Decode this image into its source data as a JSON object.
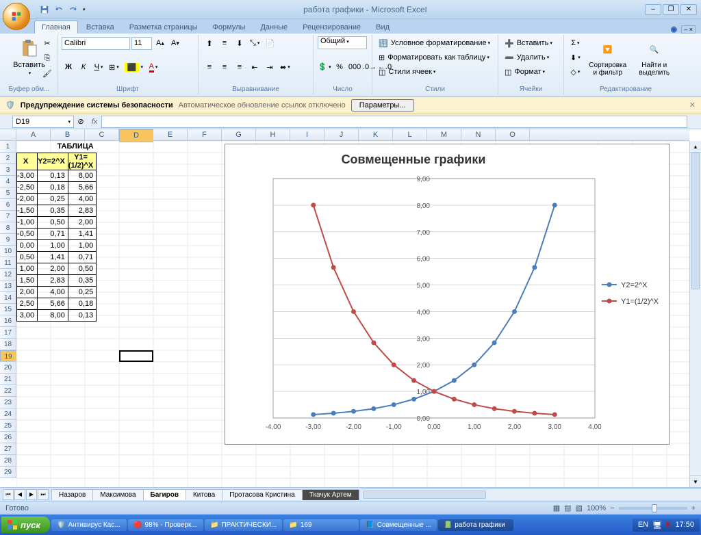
{
  "app": {
    "title": "работа графики - Microsoft Excel"
  },
  "qat": {
    "save": "save",
    "undo": "undo",
    "redo": "redo"
  },
  "tabs": [
    "Главная",
    "Вставка",
    "Разметка страницы",
    "Формулы",
    "Данные",
    "Рецензирование",
    "Вид"
  ],
  "active_tab": 0,
  "ribbon": {
    "clipboard": {
      "paste": "Вставить",
      "title": "Буфер обм..."
    },
    "font": {
      "name": "Calibri",
      "size": "11",
      "title": "Шрифт",
      "bold": "Ж",
      "italic": "К",
      "underline": "Ч"
    },
    "alignment": {
      "title": "Выравнивание"
    },
    "number": {
      "format": "Общий",
      "title": "Число"
    },
    "styles": {
      "cond": "Условное форматирование",
      "table": "Форматировать как таблицу",
      "cell": "Стили ячеек",
      "title": "Стили"
    },
    "cells": {
      "insert": "Вставить",
      "delete": "Удалить",
      "format": "Формат",
      "title": "Ячейки"
    },
    "editing": {
      "sort": "Сортировка и фильтр",
      "find": "Найти и выделить",
      "title": "Редактирование"
    }
  },
  "security": {
    "warn": "Предупреждение системы безопасности",
    "msg": "Автоматическое обновление ссылок отключено",
    "options": "Параметры..."
  },
  "namebox": "D19",
  "columns": [
    "A",
    "B",
    "C",
    "D",
    "E",
    "F",
    "G",
    "H",
    "I",
    "J",
    "K",
    "L",
    "M",
    "N",
    "O"
  ],
  "rows": [
    1,
    2,
    3,
    4,
    5,
    6,
    7,
    8,
    9,
    10,
    11,
    12,
    13,
    14,
    15,
    16,
    17,
    18,
    19,
    20,
    21,
    22,
    23,
    24,
    25,
    26,
    27,
    28,
    29
  ],
  "table": {
    "title": "ТАБЛИЦА",
    "headers": [
      "X",
      "Y2=2^X",
      "Y1=(1/2)^X"
    ],
    "rows": [
      [
        "-3,00",
        "0,13",
        "8,00"
      ],
      [
        "-2,50",
        "0,18",
        "5,66"
      ],
      [
        "-2,00",
        "0,25",
        "4,00"
      ],
      [
        "-1,50",
        "0,35",
        "2,83"
      ],
      [
        "-1,00",
        "0,50",
        "2,00"
      ],
      [
        "-0,50",
        "0,71",
        "1,41"
      ],
      [
        "0,00",
        "1,00",
        "1,00"
      ],
      [
        "0,50",
        "1,41",
        "0,71"
      ],
      [
        "1,00",
        "2,00",
        "0,50"
      ],
      [
        "1,50",
        "2,83",
        "0,35"
      ],
      [
        "2,00",
        "4,00",
        "0,25"
      ],
      [
        "2,50",
        "5,66",
        "0,18"
      ],
      [
        "3,00",
        "8,00",
        "0,13"
      ]
    ]
  },
  "chart_data": {
    "type": "line",
    "title": "Совмещенные графики",
    "x": [
      -3.0,
      -2.5,
      -2.0,
      -1.5,
      -1.0,
      -0.5,
      0.0,
      0.5,
      1.0,
      1.5,
      2.0,
      2.5,
      3.0
    ],
    "series": [
      {
        "name": "Y2=2^X",
        "color": "#4a7ebb",
        "values": [
          0.13,
          0.18,
          0.25,
          0.35,
          0.5,
          0.71,
          1.0,
          1.41,
          2.0,
          2.83,
          4.0,
          5.66,
          8.0
        ]
      },
      {
        "name": "Y1=(1/2)^X",
        "color": "#be4b48",
        "values": [
          8.0,
          5.66,
          4.0,
          2.83,
          2.0,
          1.41,
          1.0,
          0.71,
          0.5,
          0.35,
          0.25,
          0.18,
          0.13
        ]
      }
    ],
    "xlim": [
      -4,
      4
    ],
    "ylim": [
      0,
      9
    ],
    "xticks": [
      "-4,00",
      "-3,00",
      "-2,00",
      "-1,00",
      "0,00",
      "1,00",
      "2,00",
      "3,00",
      "4,00"
    ],
    "yticks": [
      "0,00",
      "1,00",
      "2,00",
      "3,00",
      "4,00",
      "5,00",
      "6,00",
      "7,00",
      "8,00",
      "9,00"
    ]
  },
  "sheets": [
    "Назаров",
    "Максимова",
    "Багиров",
    "Китова",
    "Протасова Кристина",
    "Ткачук Артем"
  ],
  "active_sheet": 2,
  "dark_sheet": 5,
  "status": {
    "ready": "Готово",
    "zoom": "100%"
  },
  "taskbar": {
    "start": "пуск",
    "items": [
      "Антивирус Кас...",
      "98% - Проверк...",
      "ПРАКТИЧЕСКИ...",
      "169",
      "Совмещенные ...",
      "работа графики"
    ],
    "active_item": 5,
    "lang": "EN",
    "clock": "17:50"
  }
}
